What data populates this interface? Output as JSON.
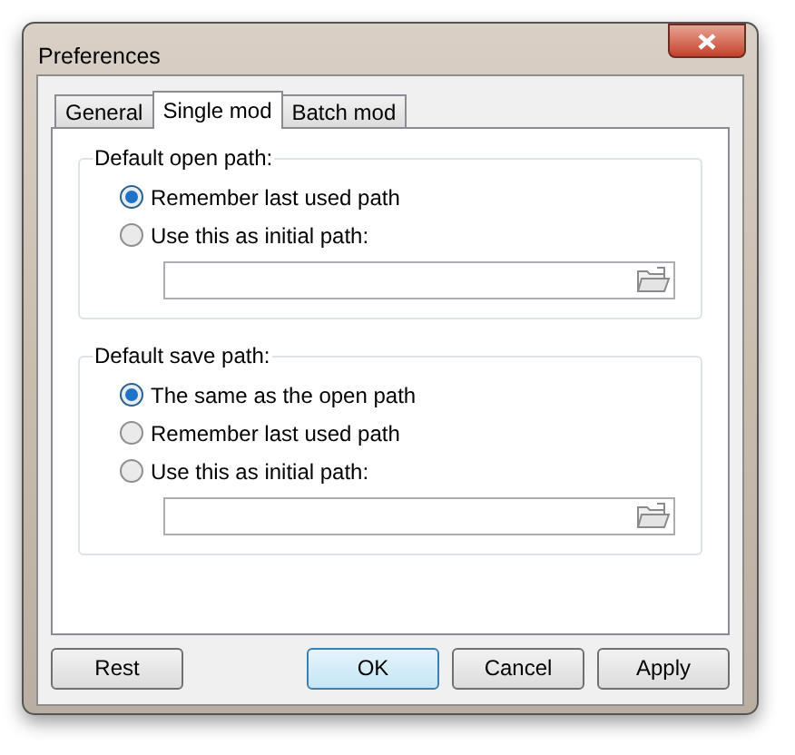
{
  "window": {
    "title": "Preferences"
  },
  "tabs": [
    {
      "label": "General",
      "selected": false
    },
    {
      "label": "Single mod",
      "selected": true
    },
    {
      "label": "Batch mod",
      "selected": false
    }
  ],
  "groups": [
    {
      "title": "Default open path:",
      "options": [
        {
          "label": "Remember last used path",
          "selected": true
        },
        {
          "label": "Use this as initial path:",
          "selected": false
        }
      ]
    },
    {
      "title": "Default save path:",
      "options": [
        {
          "label": "The same as the open path",
          "selected": true
        },
        {
          "label": "Remember last used path",
          "selected": false
        },
        {
          "label": "Use this as initial path:",
          "selected": false
        }
      ]
    }
  ],
  "buttons": [
    {
      "label": "Rest",
      "default": false
    },
    {
      "label": "OK",
      "default": true
    },
    {
      "label": "Cancel",
      "default": false
    },
    {
      "label": "Apply",
      "default": false
    }
  ]
}
